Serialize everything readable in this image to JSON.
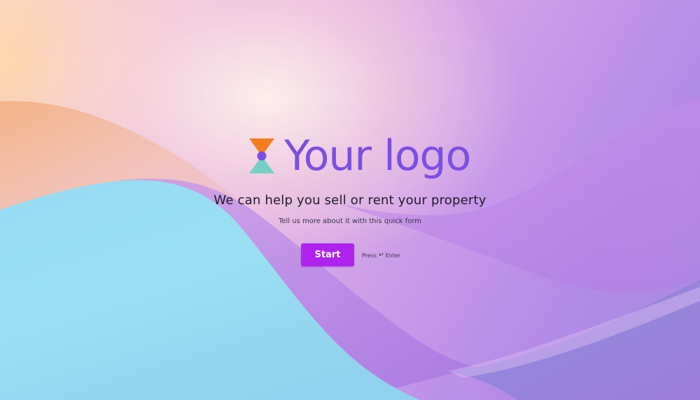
{
  "logo": {
    "text": "Your logo",
    "icon": "hourglass-logo-icon",
    "text_color": "#7a4fe3",
    "icon_colors": {
      "top": "#f47d20",
      "bottom": "#74cfc4",
      "center": "#7a4fe3"
    }
  },
  "intro": {
    "headline": "We can help you sell or rent your property",
    "subtitle": "Tell us more about it with this quick form"
  },
  "start": {
    "label": "Start",
    "color": "#b023ef"
  },
  "hint": {
    "press": "Press",
    "enter_icon": "↵",
    "key": "Enter"
  }
}
